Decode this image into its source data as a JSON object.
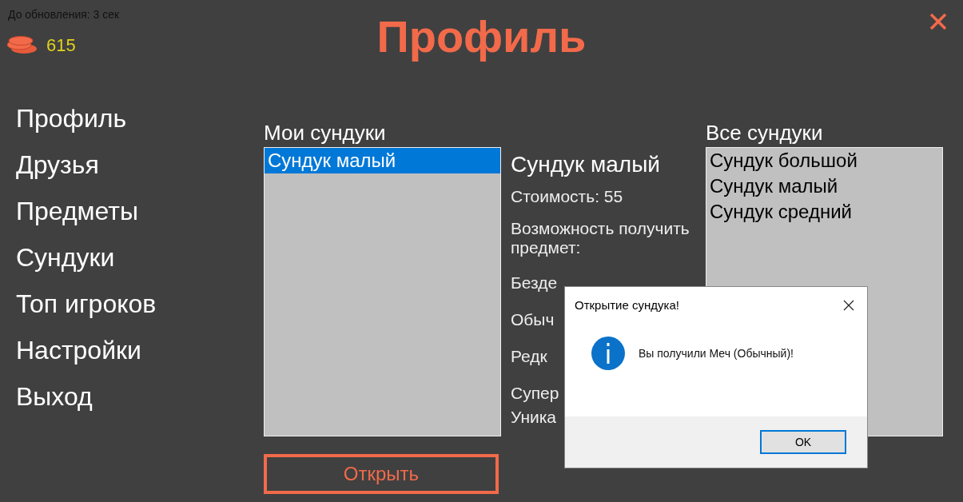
{
  "timer": "До обновления: 3 сек",
  "coins": "615",
  "title": "Профиль",
  "menu": [
    {
      "label": "Профиль"
    },
    {
      "label": "Друзья"
    },
    {
      "label": "Предметы"
    },
    {
      "label": "Сундуки"
    },
    {
      "label": "Топ игроков"
    },
    {
      "label": "Настройки"
    },
    {
      "label": "Выход"
    }
  ],
  "my_chests": {
    "heading": "Мои сундуки",
    "items": [
      {
        "label": "Сундук малый",
        "selected": true
      }
    ]
  },
  "details": {
    "name": "Сундук малый",
    "lines": [
      "Стоимость: 55",
      "Возможность получить предмет:",
      "Безде",
      "Обыч",
      "Редк",
      "Супер",
      "Уника"
    ]
  },
  "all_chests": {
    "heading": "Все сундуки",
    "items": [
      {
        "label": "Сундук большой",
        "selected": false
      },
      {
        "label": "Сундук малый",
        "selected": false
      },
      {
        "label": "Сундук средний",
        "selected": false
      }
    ]
  },
  "open_button": "Открыть",
  "dialog": {
    "title": "Открытие сундука!",
    "message": "Вы получили Меч (Обычный)!",
    "button": "OK"
  }
}
